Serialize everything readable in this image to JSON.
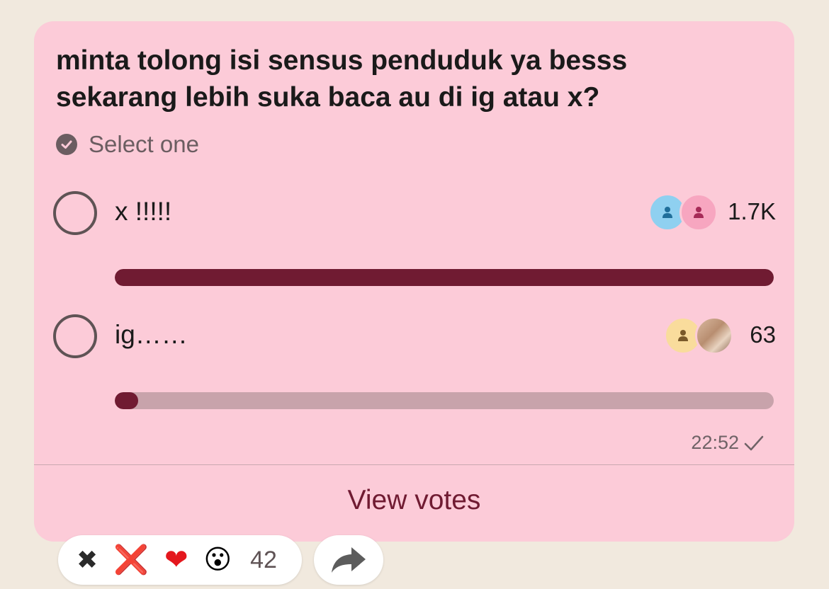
{
  "poll": {
    "question_line1": "minta tolong isi sensus penduduk ya besss",
    "question_line2": "sekarang lebih suka baca au di ig atau x?",
    "select_hint": "Select one",
    "options": [
      {
        "label": "x !!!!!",
        "count": "1.7K",
        "fraction": 1.0,
        "avatars": [
          "person-icon-blue",
          "person-icon-pink"
        ]
      },
      {
        "label": "ig……",
        "count": "63",
        "fraction": 0.035,
        "avatars": [
          "person-icon-yellow",
          "photo-avatar"
        ]
      }
    ],
    "timestamp": "22:52",
    "view_votes": "View votes"
  },
  "reactions": {
    "items": [
      "✖",
      "❌",
      "❤",
      "😮"
    ],
    "count": "42"
  },
  "colors": {
    "background": "#f1e9de",
    "bubble": "#fccbd8",
    "accent": "#701b32",
    "track": "#c8a3ab"
  }
}
